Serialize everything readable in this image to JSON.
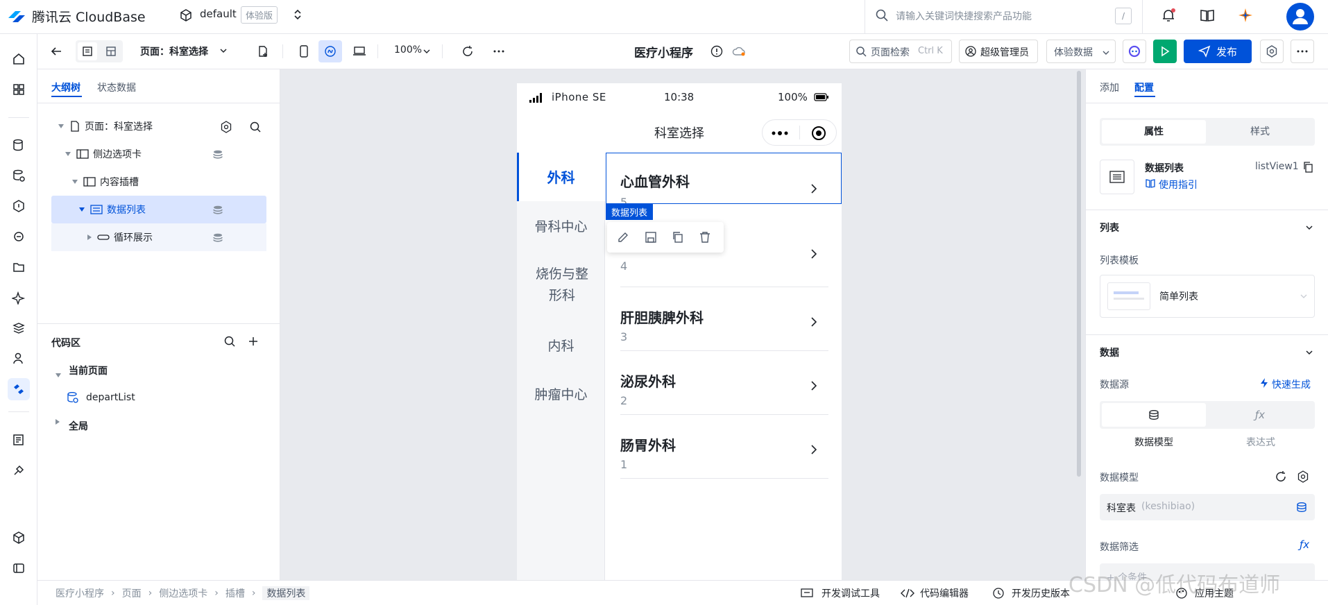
{
  "topbar": {
    "brand": "腾讯云 CloudBase",
    "env": "default",
    "env_badge": "体验版",
    "search_placeholder": "请输入关键词快捷搜索产品功能",
    "search_shortcut": "/"
  },
  "toolbar": {
    "page_label": "页面：科室选择",
    "zoom": "100%",
    "app_title": "医疗小程序",
    "page_search": "页面检索",
    "page_search_shortcut": "Ctrl K",
    "role": "超级管理员",
    "data_mode": "体验数据",
    "publish": "发布"
  },
  "leftpanel": {
    "tabs": [
      "大纲树",
      "状态数据"
    ],
    "tree": [
      "页面：科室选择",
      "侧边选项卡",
      "内容插槽",
      "数据列表",
      "循环展示"
    ],
    "code_title": "代码区",
    "current_page": "当前页面",
    "code_item": "departList",
    "global": "全局"
  },
  "phone": {
    "device": "iPhone SE",
    "time": "10:38",
    "battery": "100%",
    "nav_title": "科室选择",
    "tabs": [
      "外科",
      "骨科中心",
      "烧伤与整形科",
      "内科",
      "肿瘤中心"
    ],
    "selected_label": "数据列表",
    "items": [
      {
        "name": "心血管外科",
        "count": "5"
      },
      {
        "name": "",
        "count": "4"
      },
      {
        "name": "肝胆胰脾外科",
        "count": "3"
      },
      {
        "name": "泌尿外科",
        "count": "2"
      },
      {
        "name": "肠胃外科",
        "count": "1"
      }
    ]
  },
  "rightpanel": {
    "tabs": [
      "添加",
      "配置"
    ],
    "subtabs": [
      "属性",
      "样式"
    ],
    "comp_name": "数据列表",
    "comp_id": "listView1",
    "guide": "使用指引",
    "sec_list": "列表",
    "list_template_label": "列表模板",
    "list_template": "简单列表",
    "sec_data": "数据",
    "datasource_label": "数据源",
    "quick_gen": "快速生成",
    "ds_options": [
      "数据模型",
      "表达式"
    ],
    "model_label": "数据模型",
    "model_value": "科室表",
    "model_value_id": "(keshibiao)",
    "filter_label": "数据筛选",
    "filter_placeholder": "+ 个条件"
  },
  "statusbar": {
    "breadcrumb": [
      "医疗小程序",
      "页面",
      "侧边选项卡",
      "插槽",
      "数据列表"
    ],
    "tools": [
      "开发调试工具",
      "代码编辑器",
      "开发历史版本",
      "应用主题"
    ],
    "watermark": "CSDN @低代码布道师"
  },
  "colors": {
    "primary": "#0052d9",
    "accent_green": "#00a870"
  }
}
